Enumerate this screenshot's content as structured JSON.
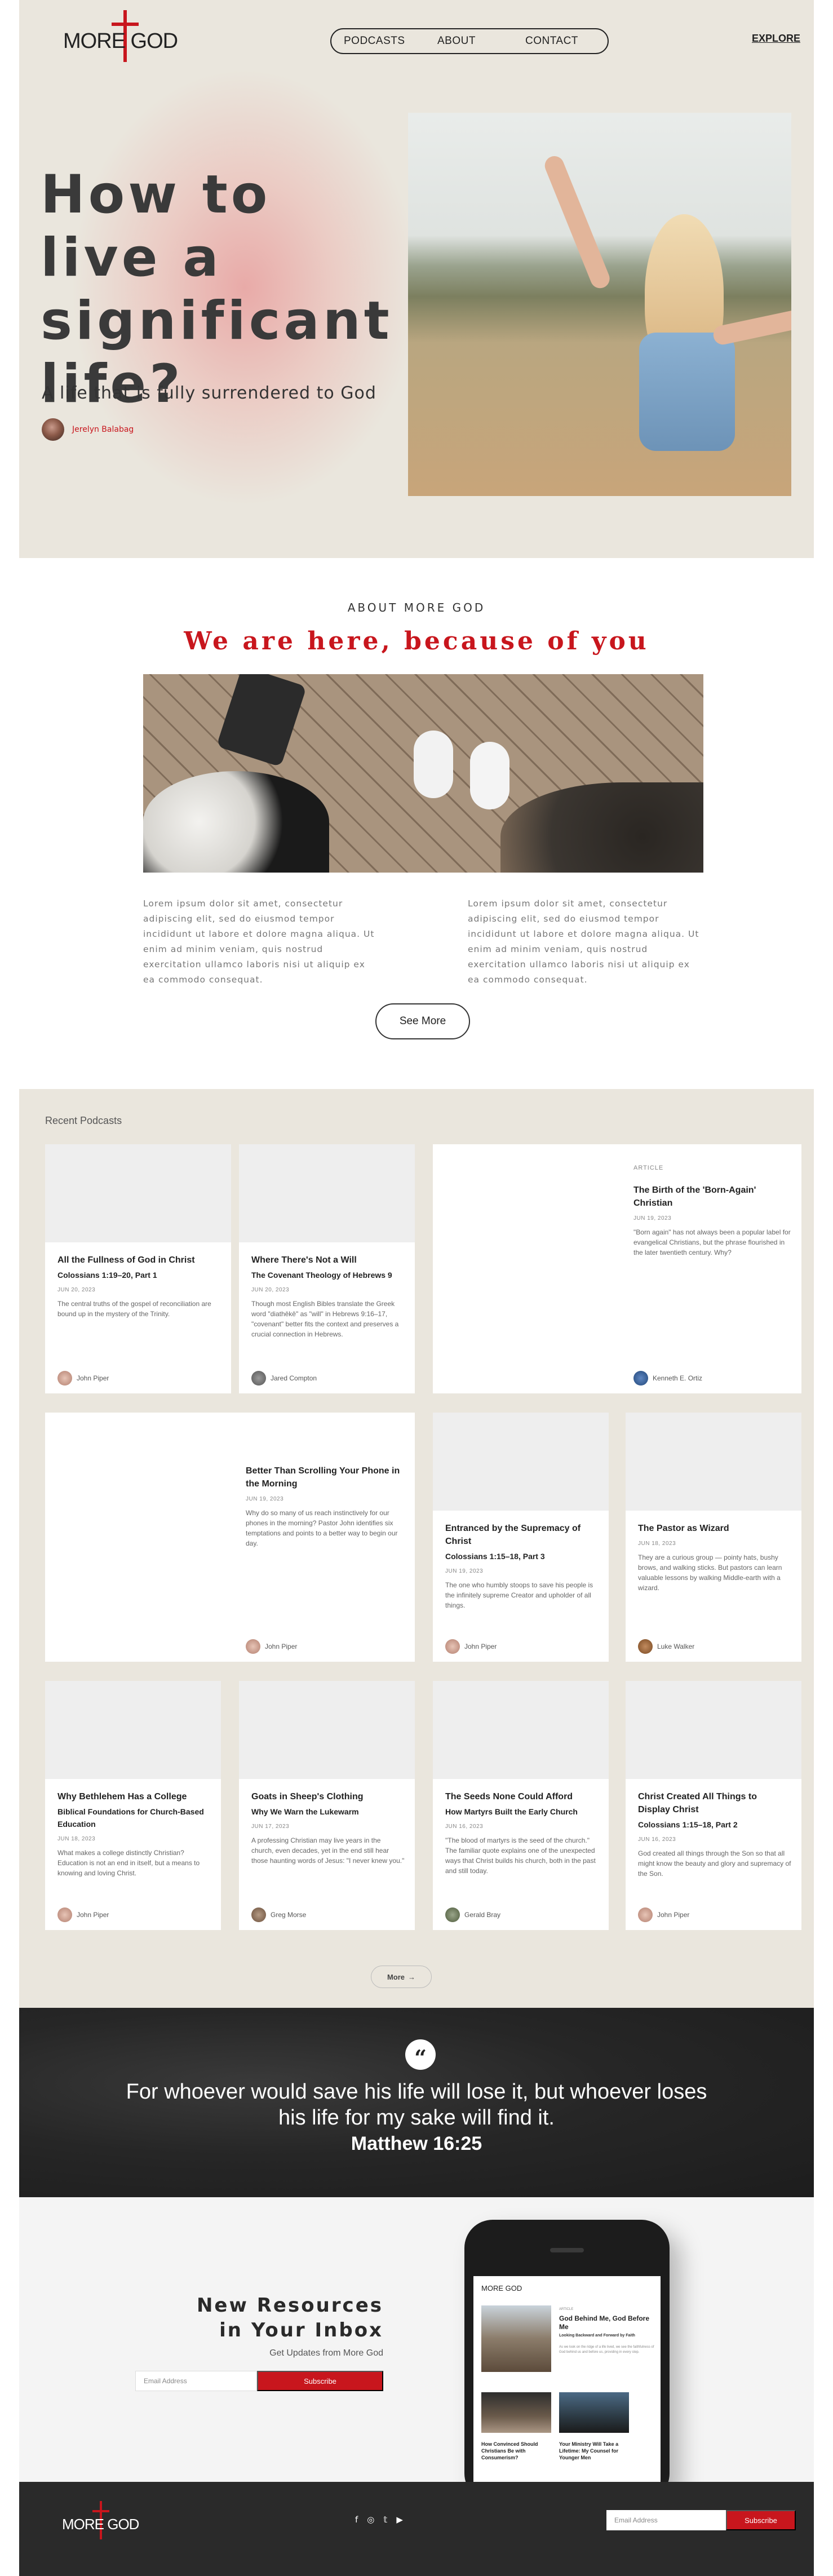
{
  "brand": {
    "logo_text": "MORE GOD",
    "accent": "#c8161d"
  },
  "nav": {
    "items": [
      "PODCASTS",
      "ABOUT",
      "CONTACT"
    ],
    "explore": "EXPLORE"
  },
  "hero": {
    "title": "How to live a significant life?",
    "subtitle": "A life that is fully surrendered to God",
    "author": "Jerelyn Balabag"
  },
  "about": {
    "label": "ABOUT MORE GOD",
    "title": "We are here, because of you",
    "col1": "Lorem ipsum dolor sit amet, consectetur adipiscing elit, sed do eiusmod tempor incididunt ut labore et dolore magna aliqua. Ut enim ad minim veniam, quis nostrud exercitation ullamco laboris nisi ut aliquip ex ea commodo consequat.",
    "col2": "Lorem ipsum dolor sit amet, consectetur adipiscing elit, sed do eiusmod tempor incididunt ut labore et dolore magna aliqua. Ut enim ad minim veniam, quis nostrud exercitation ullamco laboris nisi ut aliquip ex ea commodo consequat.",
    "button": "See More"
  },
  "podcasts": {
    "heading": "Recent Podcasts",
    "more_button": "More",
    "cards": [
      {
        "title": "All the Fullness of God in Christ",
        "subtitle": "Colossians 1:19–20, Part 1",
        "date": "JUN 20, 2023",
        "text": "The central truths of the gospel of reconciliation are bound up in the mystery of the Trinity.",
        "author": "John Piper"
      },
      {
        "title": "Where There's Not a Will",
        "subtitle": "The Covenant Theology of Hebrews 9",
        "date": "JUN 20, 2023",
        "text": "Though most English Bibles translate the Greek word \"diathēkē\" as \"will\" in Hebrews 9:16–17, \"covenant\" better fits the context and preserves a crucial connection in Hebrews.",
        "author": "Jared Compton"
      },
      {
        "tag": "ARTICLE",
        "title": "The Birth of the 'Born-Again' Christian",
        "date": "JUN 19, 2023",
        "text": "\"Born again\" has not always been a popular label for evangelical Christians, but the phrase flourished in the later twentieth century. Why?",
        "author": "Kenneth E. Ortiz"
      },
      {
        "title": "Better Than Scrolling Your Phone in the Morning",
        "date": "JUN 19, 2023",
        "text": "Why do so many of us reach instinctively for our phones in the morning? Pastor John identifies six temptations and points to a better way to begin our day.",
        "author": "John Piper"
      },
      {
        "title": "Entranced by the Supremacy of Christ",
        "subtitle": "Colossians 1:15–18, Part 3",
        "date": "JUN 19, 2023",
        "text": "The one who humbly stoops to save his people is the infinitely supreme Creator and upholder of all things.",
        "author": "John Piper"
      },
      {
        "title": "The Pastor as Wizard",
        "date": "JUN 18, 2023",
        "text": "They are a curious group — pointy hats, bushy brows, and walking sticks. But pastors can learn valuable lessons by walking Middle-earth with a wizard.",
        "author": "Luke Walker"
      },
      {
        "title": "Why Bethlehem Has a College",
        "subtitle": "Biblical Foundations for Church-Based Education",
        "date": "JUN 18, 2023",
        "text": "What makes a college distinctly Christian? Education is not an end in itself, but a means to knowing and loving Christ.",
        "author": "John Piper"
      },
      {
        "title": "Goats in Sheep's Clothing",
        "subtitle": "Why We Warn the Lukewarm",
        "date": "JUN 17, 2023",
        "text": "A professing Christian may live years in the church, even decades, yet in the end still hear those haunting words of Jesus: \"I never knew you.\"",
        "author": "Greg Morse"
      },
      {
        "title": "The Seeds None Could Afford",
        "subtitle": "How Martyrs Built the Early Church",
        "date": "JUN 16, 2023",
        "text": "\"The blood of martyrs is the seed of the church.\" The familiar quote explains one of the unexpected ways that Christ builds his church, both in the past and still today.",
        "author": "Gerald Bray"
      },
      {
        "title": "Christ Created All Things to Display Christ",
        "subtitle": "Colossians 1:15–18, Part 2",
        "date": "JUN 16, 2023",
        "text": "God created all things through the Son so that all might know the beauty and glory and supremacy of the Son.",
        "author": "John Piper"
      }
    ]
  },
  "quote": {
    "icon": "quote-icon",
    "text": "For whoever would save his life will lose it, but whoever loses his life for my sake will find it.",
    "reference": "Matthew 16:25"
  },
  "newsletter": {
    "title": "New Resources in Your Inbox",
    "subtitle": "Get Updates from More God",
    "placeholder": "Email Address",
    "button": "Subscribe",
    "phone": {
      "tag": "ARTICLE",
      "title": "God Behind Me, God Before Me",
      "subtitle": "Looking Backward and Forward by Faith",
      "text": "As we look on the ridge of a life lived, we see the faithfulness of God behind us and before us, providing in every step.",
      "title2": "How Convinced Should Christians Be with Consumerism?",
      "title3": "Your Ministry Will Take a Lifetime: My Counsel for Younger Men"
    }
  },
  "footer": {
    "logo_text": "MORE GOD",
    "social": [
      "f",
      "◎",
      "𝕥",
      "▶"
    ],
    "placeholder": "Email Address",
    "button": "Subscribe"
  }
}
